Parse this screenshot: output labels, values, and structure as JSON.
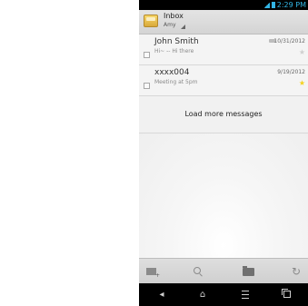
{
  "status_bar": {
    "time": "2:29 PM"
  },
  "action_bar": {
    "folder": "Inbox",
    "account": "Amy",
    "icon": "email-app-icon"
  },
  "messages": [
    {
      "sender": "John Smith",
      "snippet": "Hi~ -- Hi there",
      "date": "10/31/2012",
      "starred": false,
      "replied": true
    },
    {
      "sender": "xxxx004",
      "snippet": "Meeting at 5pm",
      "date": "9/19/2012",
      "starred": true,
      "replied": false
    }
  ],
  "load_more": "Load more messages",
  "bottom_toolbar": {
    "icons": [
      "compose-icon",
      "search-icon",
      "folder-icon",
      "refresh-icon"
    ]
  },
  "nav_bar": {
    "icons": [
      "back-icon",
      "home-icon",
      "menu-icon",
      "recent-apps-icon"
    ]
  },
  "colors": {
    "accent": "#33b5e5",
    "star": "#f4d21e"
  }
}
